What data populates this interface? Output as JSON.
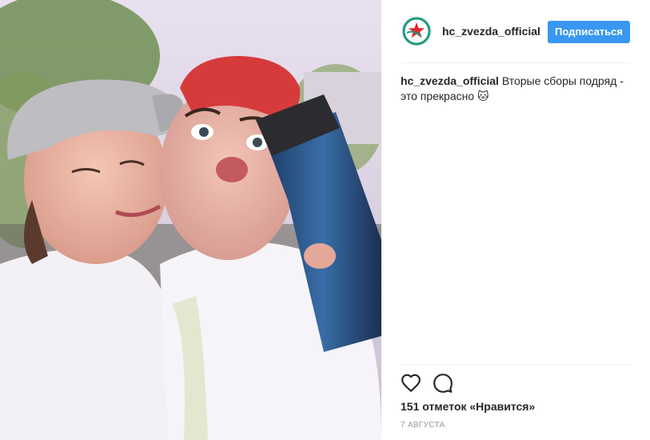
{
  "post": {
    "photo_alt": "selfie",
    "username": "hc_zvezda_official",
    "follow_label": "Подписаться",
    "caption_user": "hc_zvezda_official",
    "caption_text": " Вторые сборы подряд - это прекрасно 🐱",
    "likes": "151 отметок «Нравится»",
    "date": "7 августа"
  },
  "icons": {
    "like": "heart-outline-icon",
    "comment": "speech-bubble-icon"
  },
  "colors": {
    "follow_button": "#3897f0",
    "text": "#262626",
    "muted": "#999999",
    "divider": "#efefef",
    "avatar_star": "#e0262b",
    "avatar_ring": "#1a9a7e"
  }
}
